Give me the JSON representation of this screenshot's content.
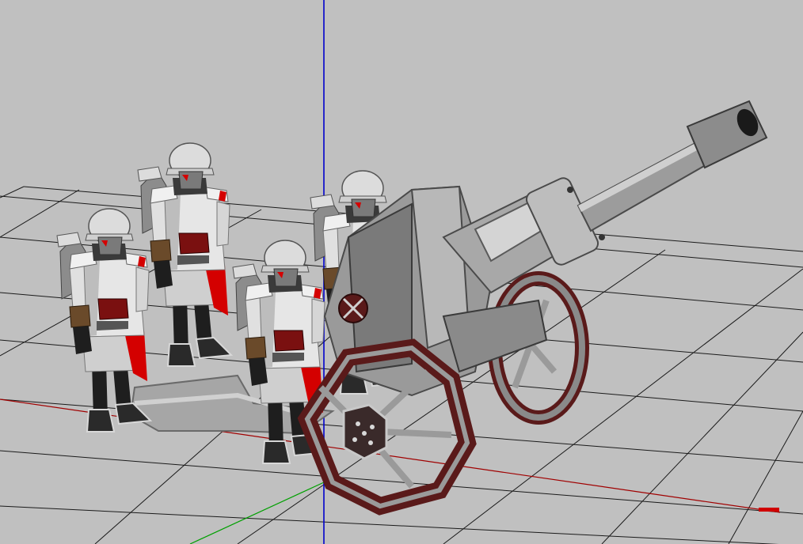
{
  "viewport": {
    "background": "#c0c0c0",
    "grid_color": "#1a1a1a",
    "axis_x_color": "#a00000",
    "axis_y_color": "#0000cc",
    "axis_z_color": "#00a000"
  },
  "scene": {
    "models": [
      {
        "kind": "soldier",
        "count": 4
      },
      {
        "kind": "artillery-cannon",
        "count": 1
      }
    ],
    "palette": {
      "armor": "#e6e6e6",
      "armor_shadow": "#8c8c8c",
      "accent_red": "#d40000",
      "leather": "#6a4a2a",
      "dark": "#1e1e1e",
      "cannon_metal": "#9a9a9a",
      "cannon_dark": "#555555",
      "wheel_rim": "#5a1a1a"
    }
  }
}
